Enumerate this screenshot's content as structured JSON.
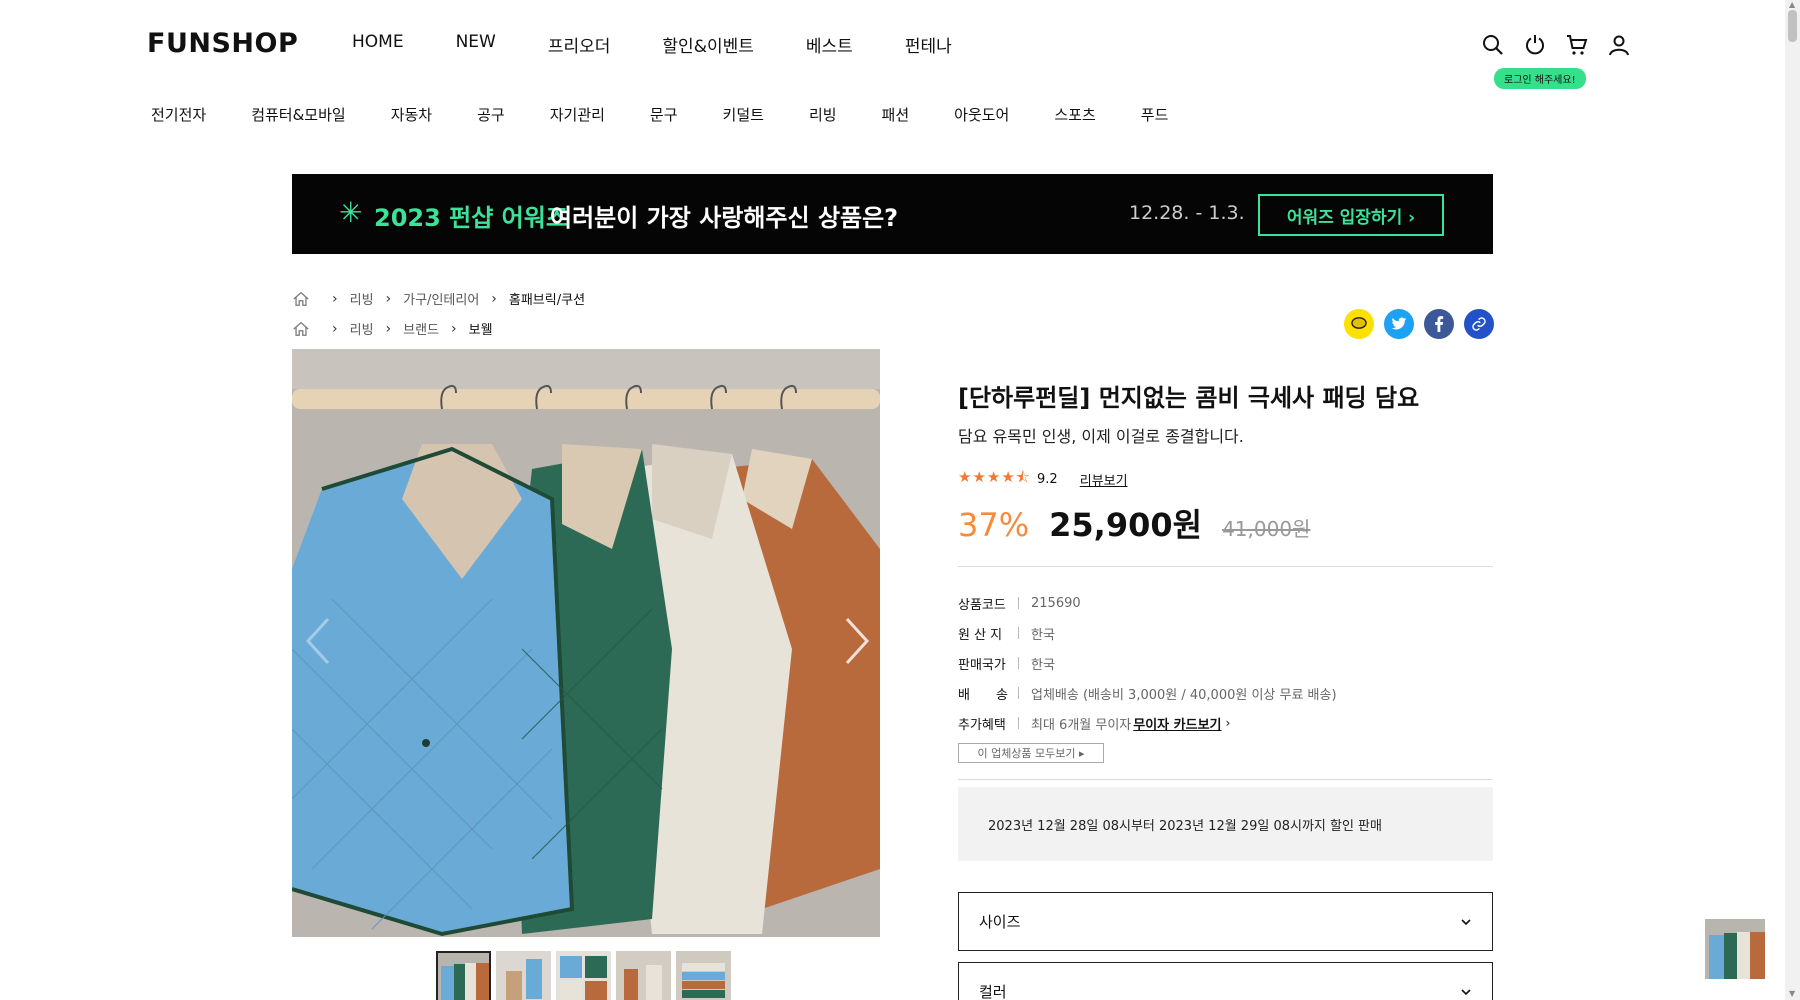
{
  "header": {
    "logo": "FUNSHOP",
    "nav": [
      "HOME",
      "NEW",
      "프리오더",
      "할인&이벤트",
      "베스트",
      "펀테나"
    ],
    "categories": [
      "전기전자",
      "컴퓨터&모바일",
      "자동차",
      "공구",
      "자기관리",
      "문구",
      "키덜트",
      "리빙",
      "패션",
      "아웃도어",
      "스포츠",
      "푸드"
    ],
    "icons": [
      "search-icon",
      "power-icon",
      "cart-icon",
      "user-icon"
    ],
    "login_tip": "로그인 해주세요!"
  },
  "banner": {
    "star": "✳",
    "highlight": "2023 펀샵 어워즈",
    "text": "여러분이 가장 사랑해주신 상품은?",
    "date": "12.28. - 1.3.",
    "button": "어워즈 입장하기 ›"
  },
  "breadcrumbs": [
    [
      "리빙",
      "가구/인테리어",
      "홈패브릭/쿠션"
    ],
    [
      "리빙",
      "브랜드",
      "보웰"
    ]
  ],
  "share": [
    "kakao-icon",
    "twitter-icon",
    "facebook-icon",
    "link-icon"
  ],
  "product": {
    "title": "[단하루펀딜] 먼지없는 콤비 극세사 패딩 담요",
    "subtitle": "담요 유목민 인생, 이제 이걸로 종결합니다.",
    "rating_stars": "★★★★⯪",
    "rating": "9.2",
    "rating_fraction": 0.92,
    "review_link": "리뷰보기",
    "discount": "37%",
    "price": "25,900원",
    "original_price": "41,000원",
    "info": [
      {
        "label": "상품코드",
        "value": "215690"
      },
      {
        "label": "원 산 지",
        "value": "한국"
      },
      {
        "label": "판매국가",
        "value": "한국"
      },
      {
        "label": "배　　송",
        "value": "업체배송 (배송비 3,000원 / 40,000원 이상 무료 배송)"
      },
      {
        "label": "추가혜택",
        "value": "최대 6개월 무이자",
        "link": "무이자 카드보기"
      }
    ],
    "vendor_button": "이 업체상품 모두보기  ▸",
    "sale_period": "2023년 12월 28일 08시부터 2023년 12월 29일 08시까지 할인 판매",
    "options": [
      "사이즈",
      "컬러"
    ]
  },
  "colors": {
    "accent_green": "#3be39a",
    "discount_orange": "#f58a3a",
    "star_orange": "#f27a30",
    "kakao": "#fae100",
    "twitter": "#1da1f2",
    "facebook": "#3b5998",
    "link": "#2352c8"
  }
}
